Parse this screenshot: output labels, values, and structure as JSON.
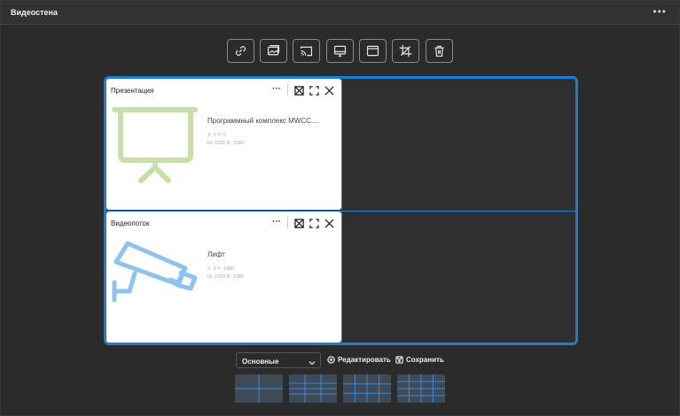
{
  "window": {
    "title": "Видеостена",
    "more_icon": "more-horizontal-icon"
  },
  "toolbar": {
    "buttons": [
      {
        "name": "link-icon"
      },
      {
        "name": "images-icon"
      },
      {
        "name": "cast-icon"
      },
      {
        "name": "monitor-icon"
      },
      {
        "name": "window-icon"
      },
      {
        "name": "crop-icon"
      },
      {
        "name": "trash-icon"
      }
    ]
  },
  "wall": {
    "accent": "#1a7fd6",
    "cards": [
      {
        "title": "Презентация",
        "name": "Программный комплекс MWCC....",
        "pos": "X: 0 Y: 0",
        "size": "Ш: 1920 В: 1080",
        "icon": "presentation-icon",
        "icon_color": "#c7dfa8"
      },
      {
        "title": "Видеопоток",
        "name": "Лифт",
        "pos": "X: 0 Y: 1080",
        "size": "Ш: 1920 В: 1080",
        "icon": "cctv-camera-icon",
        "icon_color": "#8ec3ee"
      }
    ]
  },
  "bottom": {
    "layout_select": "Основные",
    "edit_label": "Редактировать",
    "save_label": "Сохранить"
  },
  "presets": [
    "layout-2x2",
    "layout-3x2",
    "layout-4x3",
    "layout-4x3-alt"
  ]
}
